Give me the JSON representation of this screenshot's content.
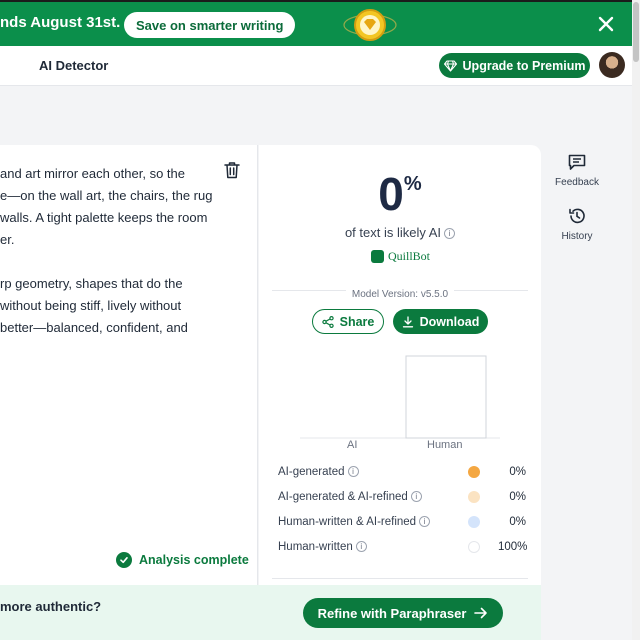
{
  "banner": {
    "text": "nds August 31st.",
    "button_label": "Save on smarter writing"
  },
  "header": {
    "title": "AI Detector",
    "premium_label": "Upgrade to Premium"
  },
  "editor": {
    "paragraph1": [
      "and art mirror each other, so the",
      "e—on the wall art, the chairs, the rug",
      " walls. A tight palette keeps the room",
      "er."
    ],
    "paragraph2": [
      "rp geometry, shapes that do the",
      " without being stiff, lively without",
      "better—balanced, confident, and"
    ],
    "status": "Analysis complete"
  },
  "results": {
    "score": "0",
    "score_unit": "%",
    "likely_text": "of text is likely AI",
    "brand": "QuillBot",
    "model_version": "Model Version: v5.5.0",
    "share_label": "Share",
    "download_label": "Download",
    "legend": [
      {
        "label": "AI-generated",
        "value": "0%",
        "color": "#f4a742"
      },
      {
        "label": "AI-generated & AI-refined",
        "value": "0%",
        "color": "#fbe3c2"
      },
      {
        "label": "Human-written & AI-refined",
        "value": "0%",
        "color": "#d4e4fb"
      },
      {
        "label": "Human-written",
        "value": "100%",
        "color": "#ffffff"
      }
    ]
  },
  "chart_data": {
    "type": "bar",
    "categories": [
      "AI",
      "Human"
    ],
    "values": [
      0,
      100
    ],
    "ylim": [
      0,
      100
    ]
  },
  "sidebar": {
    "feedback_label": "Feedback",
    "history_label": "History"
  },
  "bottom": {
    "question": "more authentic?",
    "refine_label": "Refine with Paraphraser"
  }
}
